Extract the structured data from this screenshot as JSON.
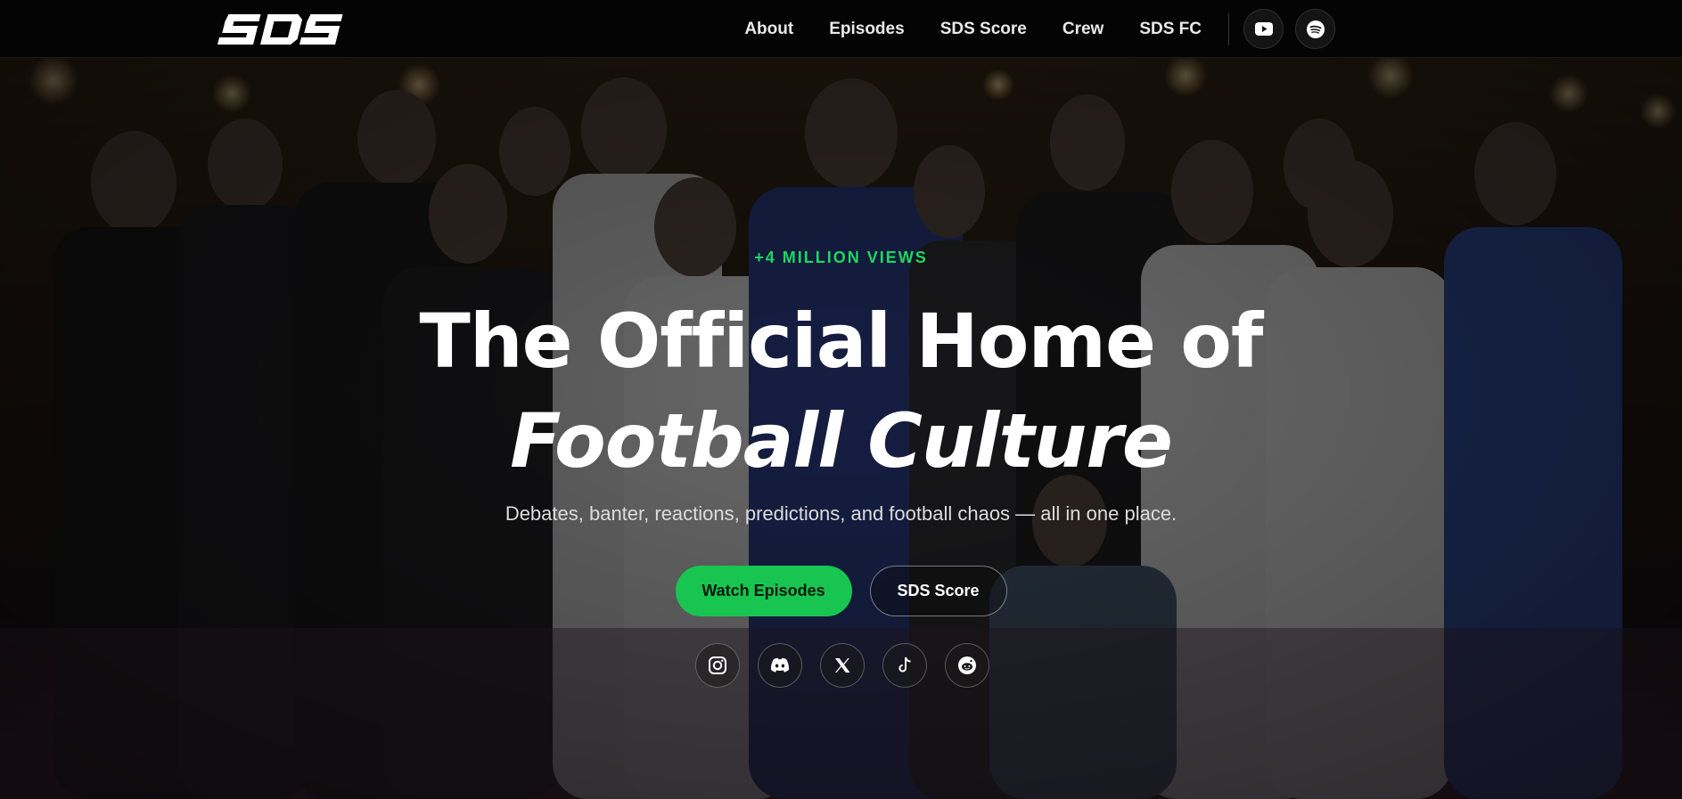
{
  "brand": {
    "logo_text": "SDS"
  },
  "nav": {
    "links": [
      "About",
      "Episodes",
      "SDS Score",
      "Crew",
      "SDS FC"
    ],
    "social": [
      {
        "icon": "youtube-icon"
      },
      {
        "icon": "spotify-icon"
      }
    ]
  },
  "hero": {
    "eyebrow": "+4 MILLION VIEWS",
    "headline_line1": "The Official Home of",
    "headline_line2": "Football Culture",
    "subtitle": "Debates, banter, reactions, predictions, and football chaos — all in one place.",
    "primary_cta": "Watch Episodes",
    "secondary_cta": "SDS Score",
    "social": [
      {
        "icon": "instagram-icon"
      },
      {
        "icon": "discord-icon"
      },
      {
        "icon": "x-icon"
      },
      {
        "icon": "tiktok-icon"
      },
      {
        "icon": "reddit-icon"
      }
    ]
  },
  "colors": {
    "accent": "#1ed760",
    "button_green": "#18c550",
    "nav_bg": "#040404"
  }
}
